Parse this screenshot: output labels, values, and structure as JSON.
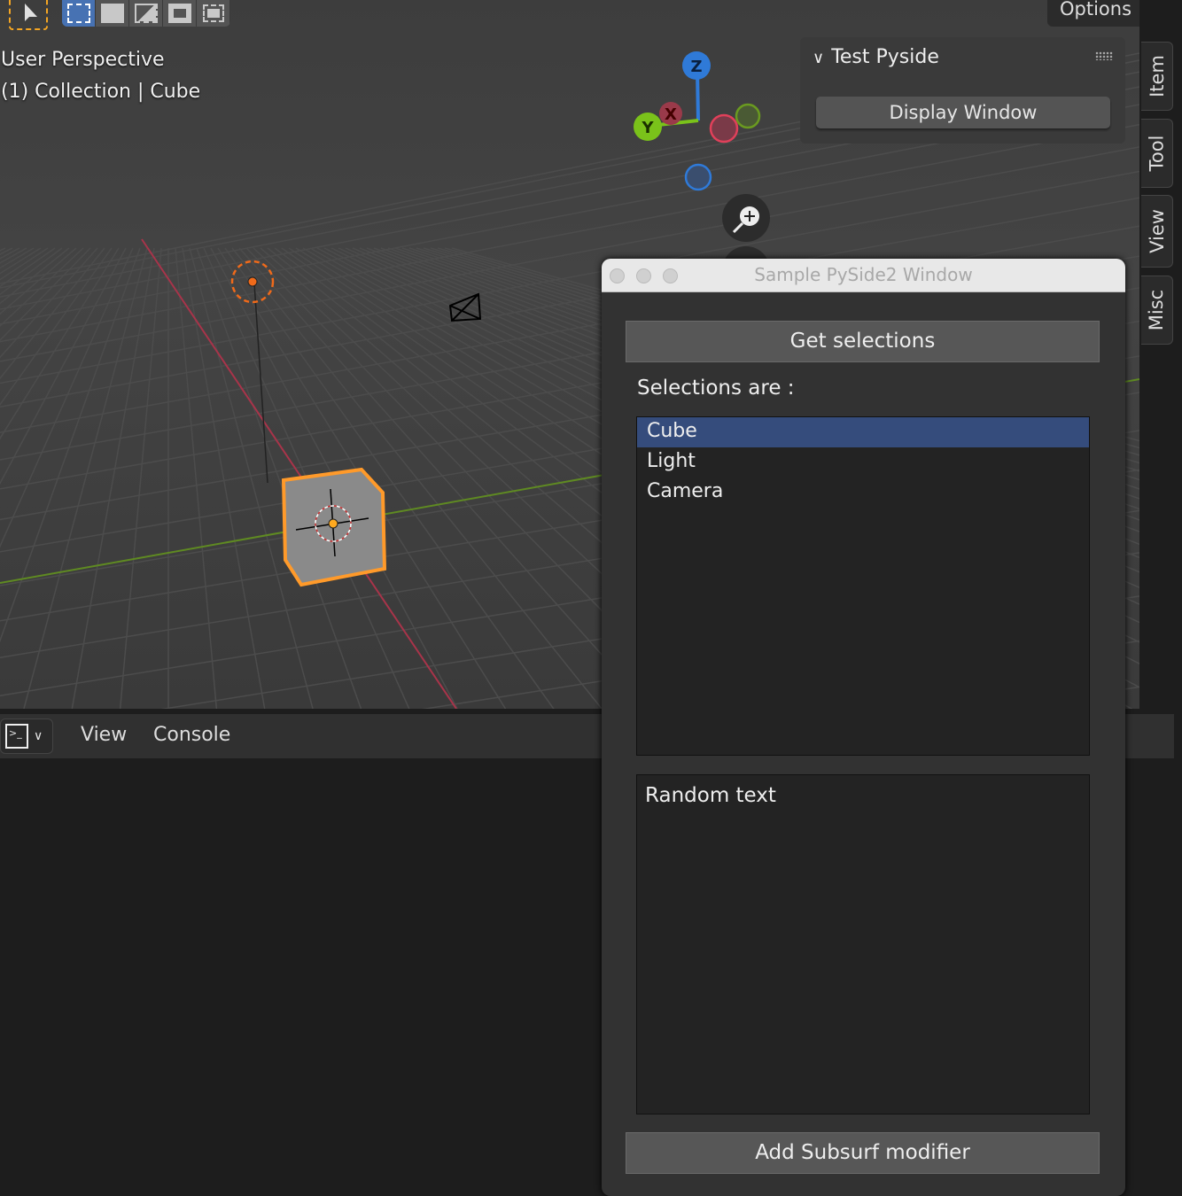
{
  "viewport": {
    "perspective": "User Perspective",
    "collection": "(1) Collection | Cube",
    "options_label": "Options",
    "toolbar": [
      {
        "icon": "select-box-icon",
        "active": true
      },
      {
        "icon": "select-extend-icon"
      },
      {
        "icon": "select-subtract-icon"
      },
      {
        "icon": "select-invert-icon"
      },
      {
        "icon": "select-intersect-icon"
      }
    ],
    "gizmo": {
      "z": "Z",
      "x": "X",
      "y": "Y",
      "colors": {
        "x": "#e0405a",
        "y": "#7ac21a",
        "z": "#2f7ad8"
      }
    }
  },
  "npanel": {
    "header": "Test Pyside",
    "button": "Display Window",
    "tabs": [
      "Item",
      "Tool",
      "View",
      "Misc"
    ]
  },
  "console": {
    "menu": [
      "View",
      "Console"
    ]
  },
  "pyside": {
    "title": "Sample PySide2 Window",
    "get_btn": "Get selections",
    "label": "Selections are :",
    "items": [
      {
        "text": "Cube",
        "selected": true
      },
      {
        "text": "Light"
      },
      {
        "text": "Camera"
      }
    ],
    "text": "Random text",
    "add_btn": "Add Subsurf modifier",
    "accent": "#354c7c"
  }
}
